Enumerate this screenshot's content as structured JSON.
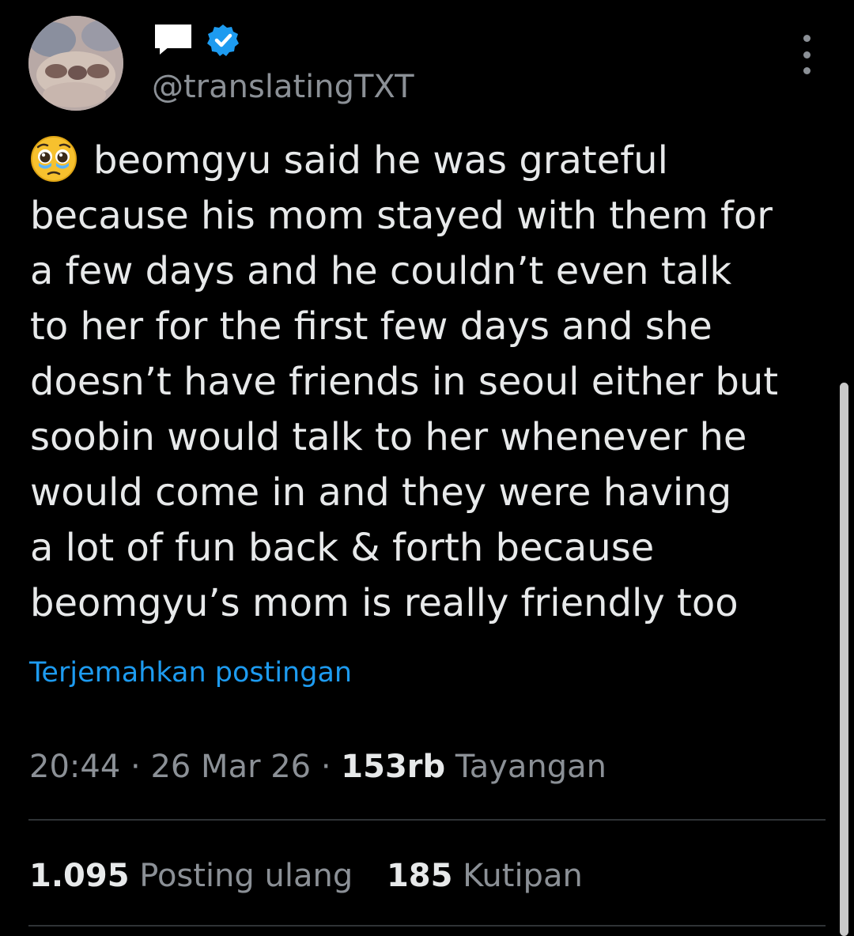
{
  "author": {
    "handle": "@translatingTXT",
    "name_icon": "white-square-emoji-icon",
    "verified_icon": "verified-badge-icon",
    "avatar_icon": "avatar-image"
  },
  "colors": {
    "background": "#000000",
    "text_primary": "#e7e9ea",
    "text_secondary": "#8b9096",
    "link": "#1d9bf0",
    "verified": "#1d9bf0",
    "divider": "#2f3336"
  },
  "tweet": {
    "emoji": "pleading-face-with-tears-icon",
    "lines": [
      "beomgyu said he was grateful",
      "because his mom stayed with them for",
      "a few days and he couldn’t even talk",
      "to her for the first few days and she",
      "doesn’t have friends in seoul either but",
      "soobin would talk to her whenever he",
      "would come in and they were having",
      "a lot of fun back & forth because",
      "beomgyu’s mom is really friendly too"
    ]
  },
  "translate_link": "Terjemahkan postingan",
  "meta": {
    "time": "20:44",
    "separator": "·",
    "date": "26 Mar 26",
    "views_count": "153rb",
    "views_label": "Tayangan"
  },
  "stats": {
    "reposts_count": "1.095",
    "reposts_label": "Posting ulang",
    "quotes_count": "185",
    "quotes_label": "Kutipan"
  }
}
